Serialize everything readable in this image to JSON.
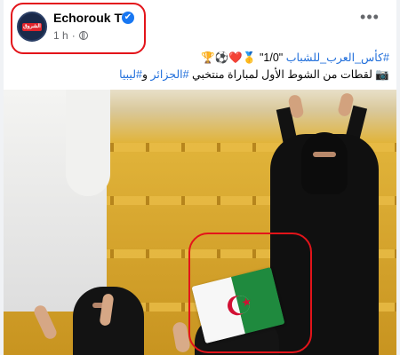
{
  "post": {
    "author": "Echorouk TV",
    "avatar_text": "الشروق",
    "verified_glyph": "✔",
    "time": "1 h",
    "dot": "·",
    "more_glyph": "•••",
    "caption_line1_parts": {
      "trophy_emojis": "🏆",
      "hashtag1": "#كأس_العرب_للشباب",
      "score": "\"1/0\"",
      "emojis": "🥇❤️⚽🏆"
    },
    "caption_line2": {
      "camera": "📷",
      "text": "لقطات من الشوط الأول لمباراة منتخبي",
      "hashtag2": "#الجزائر",
      "and": "و",
      "hashtag3": "#ليبيا"
    }
  },
  "icons": {
    "verified": "verified-badge-icon",
    "privacy": "globe-icon",
    "more": "more-options-icon",
    "camera": "camera-icon"
  },
  "colors": {
    "hashtag": "#216fdb",
    "highlight": "#e3141a",
    "verified": "#1877f2"
  }
}
